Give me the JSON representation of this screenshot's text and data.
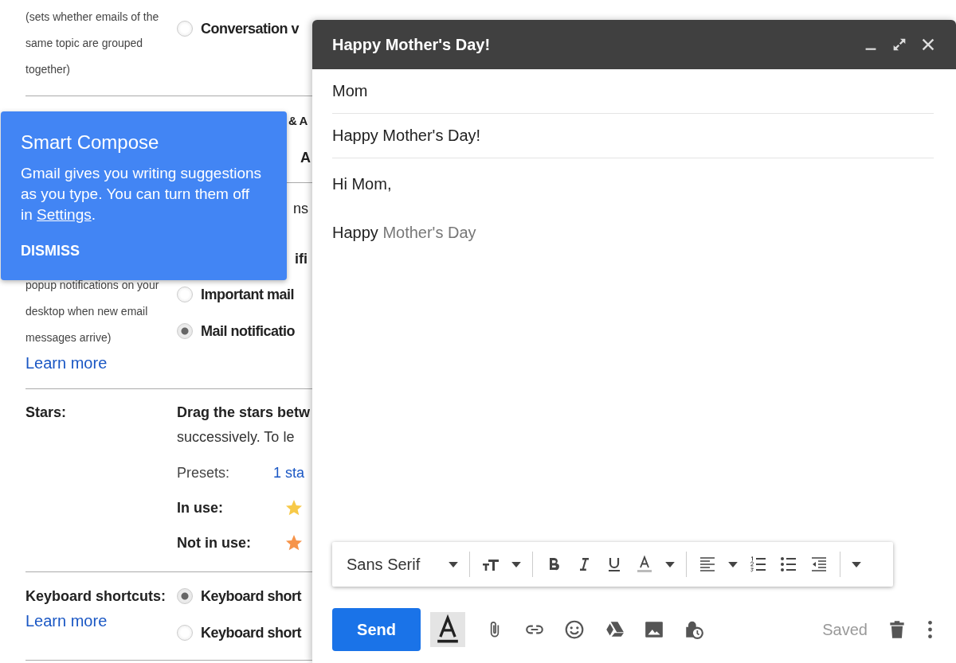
{
  "settings": {
    "conversation": {
      "description_lines": [
        "(sets whether emails of the",
        "same topic are grouped",
        "together)"
      ],
      "options": [
        {
          "label": "Conversation v",
          "selected": false
        }
      ]
    },
    "fragments_top": [
      "& A",
      "A"
    ],
    "fragments_mid": [
      "ns",
      "ifi"
    ],
    "notifications": {
      "description_lines": [
        "popup notifications on your",
        "desktop when new email",
        "messages arrive)"
      ],
      "learn_more": "Learn more",
      "options": [
        {
          "label": "Important mail",
          "selected": false
        },
        {
          "label": "Mail notificatio",
          "selected": true
        }
      ]
    },
    "stars": {
      "label": "Stars:",
      "instruction_bold": "Drag the stars betw",
      "instruction": "successively. To le",
      "presets_label": "Presets:",
      "preset": "1 sta",
      "rows": [
        {
          "label": "In use:",
          "color": "#f7c948"
        },
        {
          "label": "Not in use:",
          "color": "#f6944a"
        }
      ]
    },
    "keyboard": {
      "label": "Keyboard shortcuts:",
      "learn_more": "Learn more",
      "options": [
        {
          "label": "Keyboard short",
          "selected": true
        },
        {
          "label": "Keyboard short",
          "selected": false
        }
      ]
    }
  },
  "popup": {
    "title": "Smart Compose",
    "body_before": "Gmail gives you writing suggestions as you type. You can turn them off in ",
    "link": "Settings",
    "body_after": ".",
    "button": "DISMISS"
  },
  "compose": {
    "title": "Happy Mother's Day!",
    "to": "Mom",
    "subject": "Happy Mother's Day!",
    "greeting": "Hi Mom,",
    "typed": "Happy",
    "suggestion": "Mother's Day",
    "toolbar": {
      "font": "Sans Serif"
    },
    "send": "Send",
    "status": "Saved"
  }
}
